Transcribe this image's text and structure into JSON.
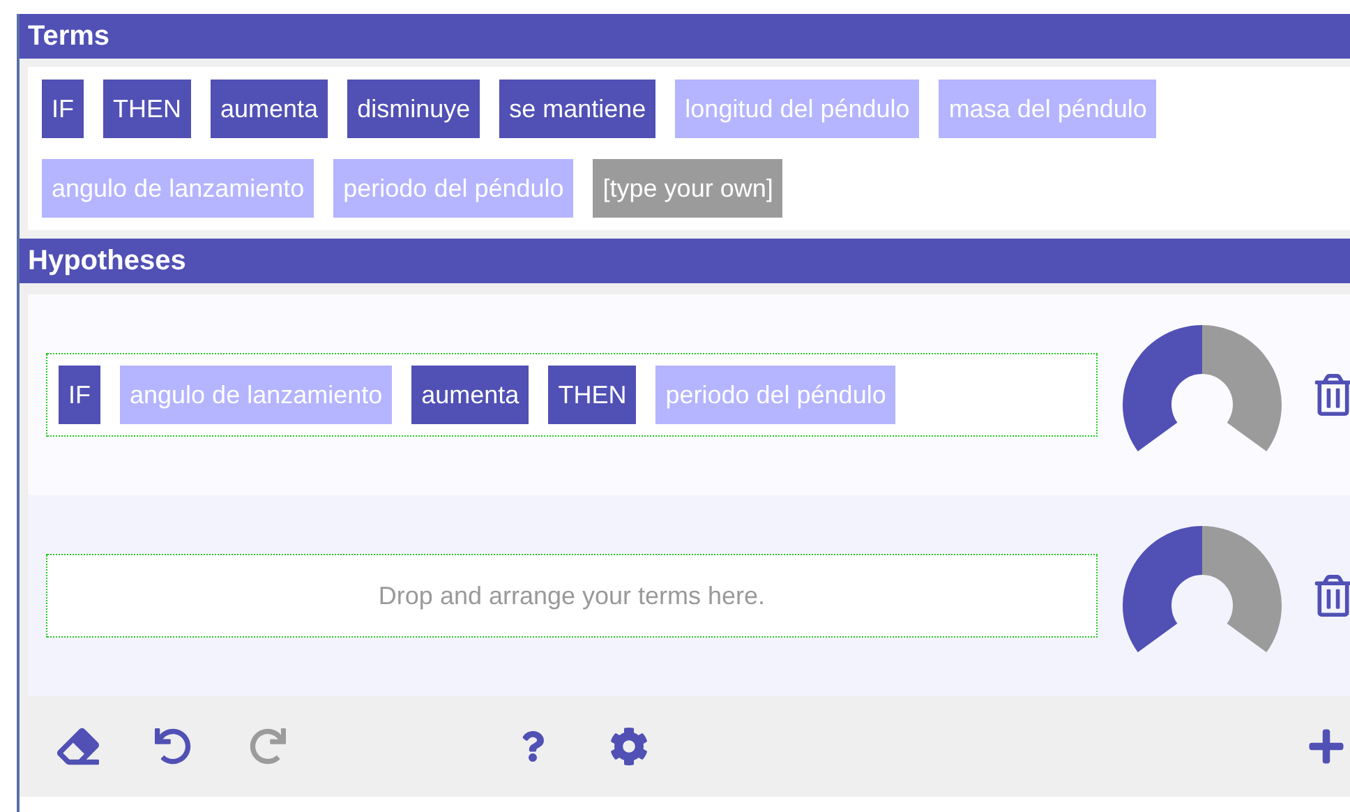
{
  "terms": {
    "title": "Terms",
    "chips": [
      {
        "label": "IF",
        "kind": "operator"
      },
      {
        "label": "THEN",
        "kind": "operator"
      },
      {
        "label": "aumenta",
        "kind": "operator"
      },
      {
        "label": "disminuye",
        "kind": "operator"
      },
      {
        "label": "se mantiene",
        "kind": "operator"
      },
      {
        "label": "longitud del péndulo",
        "kind": "variable"
      },
      {
        "label": "masa del péndulo",
        "kind": "variable"
      },
      {
        "label": "angulo de lanzamiento",
        "kind": "variable"
      },
      {
        "label": "periodo del péndulo",
        "kind": "variable"
      },
      {
        "label": "[type your own]",
        "kind": "custom"
      }
    ]
  },
  "hypotheses": {
    "title": "Hypotheses",
    "rows": [
      {
        "chips": [
          {
            "label": "IF",
            "kind": "operator"
          },
          {
            "label": "angulo de lanzamiento",
            "kind": "variable"
          },
          {
            "label": "aumenta",
            "kind": "operator"
          },
          {
            "label": "THEN",
            "kind": "operator"
          },
          {
            "label": "periodo del péndulo",
            "kind": "variable"
          }
        ],
        "gauge": {
          "level": 0.5
        }
      },
      {
        "placeholder": "Drop and arrange your terms here.",
        "chips": [],
        "gauge": {
          "level": 0.5
        }
      }
    ]
  },
  "toolbar": {
    "undo": {
      "disabled": false
    },
    "redo": {
      "disabled": true
    }
  }
}
